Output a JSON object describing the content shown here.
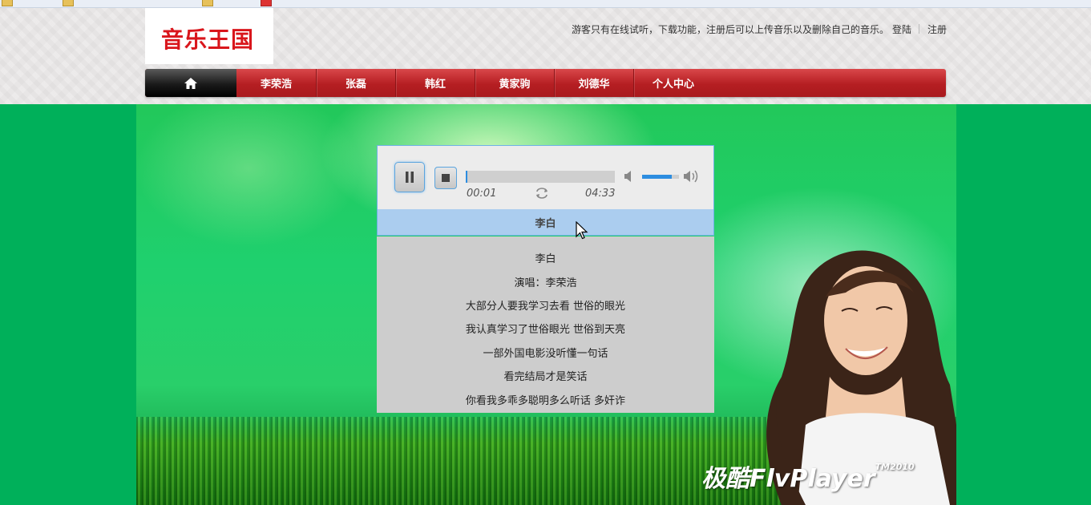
{
  "site": {
    "logo_text": "音乐王国",
    "notice": "游客只有在线试听，下载功能，注册后可以上传音乐以及删除自己的音乐。",
    "login_label": "登陆",
    "register_label": "注册"
  },
  "nav": {
    "home_icon": "home-icon",
    "items": [
      {
        "label": "李荣浩"
      },
      {
        "label": "张磊"
      },
      {
        "label": "韩红"
      },
      {
        "label": "黄家驹"
      },
      {
        "label": "刘德华"
      },
      {
        "label": "个人中心"
      }
    ]
  },
  "player": {
    "current_time": "00:01",
    "total_time": "04:33",
    "progress": 0.01,
    "volume": 0.8,
    "track_title": "李白",
    "lyrics": [
      "李白",
      "演唱：李荣浩",
      "大部分人要我学习去看 世俗的眼光",
      "我认真学习了世俗眼光 世俗到天亮",
      "一部外国电影没听懂一句话",
      "看完结局才是笑话",
      "你看我多乖多聪明多么听话 多奸诈"
    ],
    "watermark": "极酷FlvPlayer",
    "watermark_tm": "TM2010"
  },
  "colors": {
    "nav_red": "#b51e22",
    "stage_green": "#00b05a",
    "accent_blue": "#2d8de0",
    "title_bar": "#abcdef"
  }
}
